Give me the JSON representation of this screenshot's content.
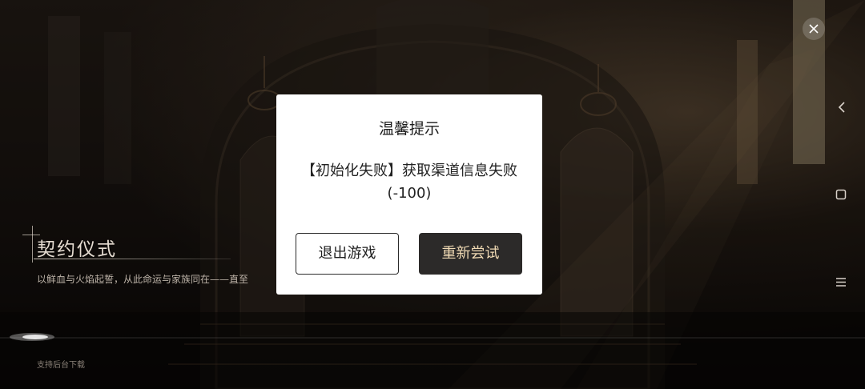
{
  "game": {
    "title": "契约仪式",
    "subtitle": "以鲜血与火焰起誓，从此命运与家族同在——直至",
    "bg_download": "支持后台下载"
  },
  "dialog": {
    "title": "温馨提示",
    "message": "【初始化失败】获取渠道信息失败(-100)",
    "exit_label": "退出游戏",
    "retry_label": "重新尝试"
  },
  "side_controls": {
    "back_icon": "chevron-left-icon",
    "home_icon": "square-icon",
    "menu_icon": "hamburger-menu-icon",
    "close_icon": "close-icon"
  },
  "colors": {
    "retry_button_bg": "#2c2a29",
    "retry_button_text": "#efd9b3",
    "dialog_bg": "#ffffff"
  }
}
